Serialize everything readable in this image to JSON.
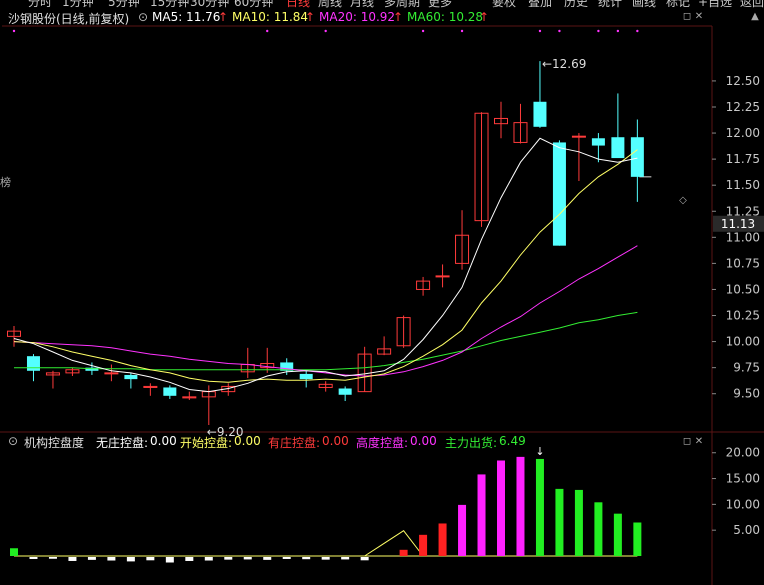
{
  "topbar": {
    "items": [
      "分时",
      "1分钟",
      "5分钟",
      "15分钟",
      "30分钟",
      "60分钟",
      "日线",
      "周线",
      "月线",
      "多周期",
      "更多"
    ],
    "active_index": 6,
    "right_items": [
      "要权",
      "叠加",
      "历史",
      "统计",
      "画线",
      "标记",
      "+自选",
      "返回"
    ]
  },
  "main_legend": {
    "title": "沙钢股份(日线,前复权)",
    "ma5": "MA5: 11.76",
    "ma10": "MA10: 11.84",
    "ma20": "MA20: 10.92",
    "ma60": "MA60: 10.28",
    "arrow": "↑"
  },
  "sub_legend": {
    "title": "机构控盘度",
    "wuzhuang_label": "无庄控盘:",
    "wuzhuang_value": "0.00",
    "kaishi_label": "开始控盘:",
    "kaishi_value": "0.00",
    "youzhuang_label": "有庄控盘:",
    "youzhuang_value": "0.00",
    "gaodu_label": "高度控盘:",
    "gaodu_value": "0.00",
    "zhuli_label": "主力出货:",
    "zhuli_value": "6.49"
  },
  "left_glyph": "榜",
  "colors": {
    "up": "#ff3b3b",
    "down": "#54ffff",
    "ma5": "#ffffff",
    "ma10": "#ffff66",
    "ma20": "#ff33ff",
    "ma60": "#33ee33",
    "white_bar": "#ffffff",
    "sub_green": "#22ee22",
    "sub_red": "#ff2222",
    "sub_magenta": "#ff22ff",
    "sub_yellow": "#ffff66",
    "axis_text": "#c8c8c8",
    "grid": "#4a1010"
  },
  "chart_data": [
    {
      "type": "candlestick",
      "ylim": [
        9.2,
        12.95
      ],
      "yticks": [
        "12.50",
        "12.25",
        "12.00",
        "11.75",
        "11.50",
        "11.25",
        "11.00",
        "10.75",
        "10.50",
        "10.25",
        "10.00",
        "9.75",
        "9.50"
      ],
      "current_price_label": "11.13",
      "annotations": [
        {
          "text": "12.69",
          "kind": "high"
        },
        {
          "text": "9.20",
          "kind": "low"
        }
      ],
      "candles": [
        {
          "o": 10.05,
          "h": 10.15,
          "l": 9.95,
          "c": 10.1
        },
        {
          "o": 9.86,
          "h": 9.88,
          "l": 9.62,
          "c": 9.72
        },
        {
          "o": 9.68,
          "h": 9.72,
          "l": 9.55,
          "c": 9.7
        },
        {
          "o": 9.7,
          "h": 9.75,
          "l": 9.67,
          "c": 9.73
        },
        {
          "o": 9.75,
          "h": 9.8,
          "l": 9.68,
          "c": 9.72
        },
        {
          "o": 9.7,
          "h": 9.78,
          "l": 9.62,
          "c": 9.7
        },
        {
          "o": 9.68,
          "h": 9.7,
          "l": 9.55,
          "c": 9.64
        },
        {
          "o": 9.56,
          "h": 9.6,
          "l": 9.48,
          "c": 9.57
        },
        {
          "o": 9.56,
          "h": 9.58,
          "l": 9.45,
          "c": 9.48
        },
        {
          "o": 9.46,
          "h": 9.52,
          "l": 9.44,
          "c": 9.47
        },
        {
          "o": 9.47,
          "h": 9.58,
          "l": 9.2,
          "c": 9.52
        },
        {
          "o": 9.52,
          "h": 9.6,
          "l": 9.48,
          "c": 9.57
        },
        {
          "o": 9.71,
          "h": 9.94,
          "l": 9.65,
          "c": 9.78
        },
        {
          "o": 9.75,
          "h": 9.94,
          "l": 9.7,
          "c": 9.79
        },
        {
          "o": 9.8,
          "h": 9.84,
          "l": 9.68,
          "c": 9.72
        },
        {
          "o": 9.69,
          "h": 9.72,
          "l": 9.56,
          "c": 9.64
        },
        {
          "o": 9.56,
          "h": 9.62,
          "l": 9.52,
          "c": 9.59
        },
        {
          "o": 9.55,
          "h": 9.57,
          "l": 9.43,
          "c": 9.49
        },
        {
          "o": 9.52,
          "h": 9.95,
          "l": 9.52,
          "c": 9.88
        },
        {
          "o": 9.88,
          "h": 10.05,
          "l": 9.87,
          "c": 9.93
        },
        {
          "o": 9.96,
          "h": 10.25,
          "l": 9.94,
          "c": 10.23
        },
        {
          "o": 10.5,
          "h": 10.62,
          "l": 10.44,
          "c": 10.58
        },
        {
          "o": 10.63,
          "h": 10.74,
          "l": 10.52,
          "c": 10.63
        },
        {
          "o": 10.75,
          "h": 11.26,
          "l": 10.69,
          "c": 11.02
        },
        {
          "o": 11.16,
          "h": 12.2,
          "l": 11.1,
          "c": 12.19
        },
        {
          "o": 12.09,
          "h": 12.3,
          "l": 11.95,
          "c": 12.14
        },
        {
          "o": 11.91,
          "h": 12.28,
          "l": 11.9,
          "c": 12.1
        },
        {
          "o": 12.3,
          "h": 12.69,
          "l": 12.05,
          "c": 12.06
        },
        {
          "o": 11.91,
          "h": 11.93,
          "l": 10.92,
          "c": 10.92
        },
        {
          "o": 11.97,
          "h": 12.0,
          "l": 11.54,
          "c": 11.97
        },
        {
          "o": 11.95,
          "h": 12.0,
          "l": 11.72,
          "c": 11.88
        },
        {
          "o": 11.96,
          "h": 12.38,
          "l": 11.82,
          "c": 11.76
        },
        {
          "o": 11.96,
          "h": 12.13,
          "l": 11.34,
          "c": 11.58
        }
      ],
      "ma5": [
        10.03,
        9.98,
        9.9,
        9.82,
        9.77,
        9.72,
        9.7,
        9.66,
        9.61,
        9.54,
        9.52,
        9.55,
        9.6,
        9.67,
        9.71,
        9.72,
        9.71,
        9.67,
        9.69,
        9.72,
        9.83,
        10.02,
        10.25,
        10.52,
        10.98,
        11.38,
        11.72,
        11.95,
        11.86,
        11.82,
        11.75,
        11.72,
        11.76
      ],
      "ma10": [
        10.0,
        9.99,
        9.95,
        9.9,
        9.86,
        9.82,
        9.77,
        9.73,
        9.7,
        9.65,
        9.62,
        9.61,
        9.63,
        9.64,
        9.63,
        9.63,
        9.64,
        9.63,
        9.66,
        9.69,
        9.76,
        9.86,
        9.97,
        10.11,
        10.37,
        10.58,
        10.83,
        11.05,
        11.22,
        11.42,
        11.58,
        11.7,
        11.84
      ],
      "ma20": [
        10.0,
        9.99,
        9.98,
        9.97,
        9.96,
        9.94,
        9.91,
        9.88,
        9.86,
        9.83,
        9.81,
        9.79,
        9.78,
        9.76,
        9.74,
        9.72,
        9.7,
        9.68,
        9.67,
        9.68,
        9.71,
        9.76,
        9.82,
        9.9,
        10.03,
        10.14,
        10.24,
        10.37,
        10.48,
        10.6,
        10.7,
        10.81,
        10.92
      ],
      "ma60": [
        9.75,
        9.75,
        9.75,
        9.75,
        9.74,
        9.74,
        9.74,
        9.73,
        9.73,
        9.73,
        9.73,
        9.73,
        9.73,
        9.73,
        9.73,
        9.73,
        9.73,
        9.74,
        9.75,
        9.77,
        9.8,
        9.83,
        9.87,
        9.91,
        9.96,
        10.01,
        10.05,
        10.09,
        10.13,
        10.18,
        10.21,
        10.25,
        10.28
      ]
    },
    {
      "type": "bar",
      "ylim": [
        0,
        21.5
      ],
      "yticks": [
        "20.00",
        "15.00",
        "10.00",
        "5.00"
      ],
      "white_bars": [
        0,
        0.9,
        0.8,
        1.8,
        1.3,
        1.6,
        2.0,
        1.5,
        2.5,
        1.8,
        1.6,
        1.2,
        1.1,
        1.3,
        0.9,
        1.0,
        1.2,
        1.1,
        1.5,
        0,
        0,
        0,
        0,
        0,
        0,
        0,
        0,
        0,
        0,
        0,
        0,
        0,
        0
      ],
      "green_bars": [
        1.5,
        0,
        0,
        0,
        0,
        0,
        0,
        0,
        0,
        0,
        0,
        0,
        0,
        0,
        0,
        0,
        0,
        0,
        0,
        0,
        0,
        0,
        0,
        0,
        0,
        0,
        0,
        0,
        13.0,
        12.8,
        12.8,
        10.4,
        8.2,
        6.49
      ],
      "red_bars": [
        0,
        0,
        0,
        0,
        0,
        0,
        0,
        0,
        0,
        0,
        0,
        0,
        0,
        0,
        0,
        0,
        0,
        0,
        0,
        0,
        1.2,
        4.1,
        6.3,
        0,
        0,
        0,
        0,
        0,
        0,
        0,
        0,
        0,
        0
      ],
      "magenta_bars": [
        0,
        0,
        0,
        0,
        0,
        0,
        0,
        0,
        0,
        0,
        0,
        0,
        0,
        0,
        0,
        0,
        0,
        0,
        0,
        0,
        0,
        0,
        0,
        9.9,
        15.8,
        18.5,
        19.2,
        0,
        0,
        0,
        0,
        0,
        0
      ],
      "green_bars_trimmed": [
        1.5,
        0,
        0,
        0,
        0,
        0,
        0,
        0,
        0,
        0,
        0,
        0,
        0,
        0,
        0,
        0,
        0,
        0,
        0,
        0,
        0,
        0,
        0,
        0,
        0,
        0,
        0,
        18.8,
        13.0,
        12.8,
        10.4,
        8.2,
        6.49
      ],
      "yellow_line": [
        0,
        0,
        0,
        0,
        0,
        0,
        0,
        0,
        0,
        0,
        0,
        0,
        0,
        0,
        0,
        0,
        0,
        0,
        0,
        0,
        0,
        0,
        0,
        0,
        0,
        0,
        0,
        0,
        0,
        0,
        0,
        0,
        0
      ],
      "yellow_peak": 4.9
    }
  ]
}
